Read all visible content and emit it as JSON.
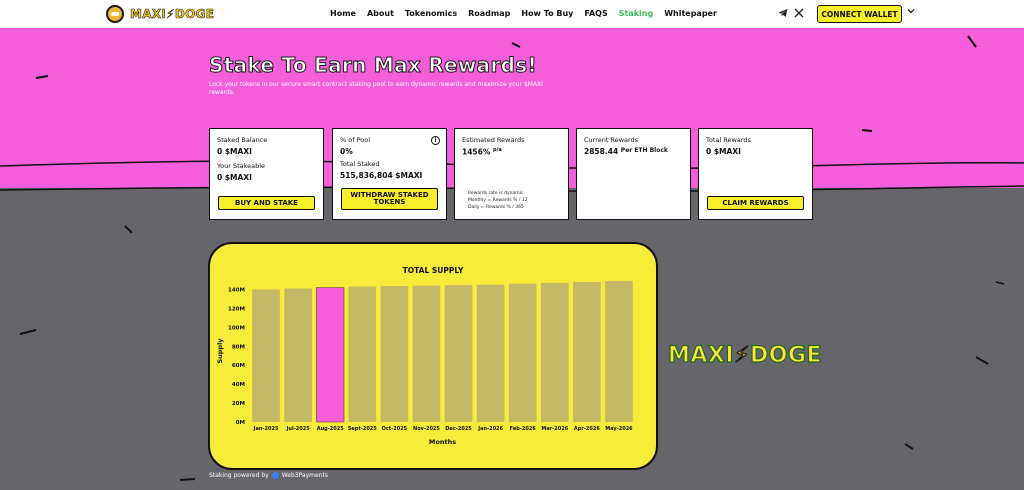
{
  "nav": {
    "links": [
      "Home",
      "About",
      "Tokenomics",
      "Roadmap",
      "How To Buy",
      "FAQS",
      "Staking",
      "Whitepaper"
    ],
    "active_index": 6,
    "logo_text": "MAXI",
    "logo_text2": "DOGE",
    "connect_label": "CONNECT WALLET",
    "telegram_icon": "telegram-icon",
    "x_icon": "x-icon"
  },
  "hero": {
    "title": "Stake To Earn Max Rewards!",
    "desc": "Lock your tokens in our secure smart contract staking pool to earn dynamic rewards and maximize your $MAXI rewards."
  },
  "cards": {
    "staked_balance_label": "Staked Balance",
    "staked_balance_value": "0 $MAXI",
    "stakeable_label": "Your Stakeable",
    "stakeable_value": "0 $MAXI",
    "buy_stake_label": "BUY AND STAKE",
    "pool_label": "% of Pool",
    "pool_value": "0%",
    "total_staked_label": "Total Staked",
    "total_staked_value": "515,836,804 $MAXI",
    "withdraw_label_1": "WITHDRAW STAKED",
    "withdraw_label_2": "TOKENS",
    "est_rewards_label": "Estimated Rewards",
    "est_rewards_value": "1456%",
    "est_rewards_unit": "p/a",
    "rewards_note_1": "Rewards rate is dynamic",
    "rewards_note_2": "Monthly = Rewards % / 12",
    "rewards_note_3": "Daily = Rewards % / 365",
    "current_rewards_label": "Current Rewards",
    "current_rewards_value": "2858.44",
    "current_rewards_unit": "Per ETH Block",
    "total_rewards_label": "Total Rewards",
    "total_rewards_value": "0 $MAXI",
    "claim_label": "CLAIM REWARDS"
  },
  "chart_data": {
    "type": "bar",
    "title": "TOTAL SUPPLY",
    "xlabel": "Months",
    "ylabel": "Supply",
    "categories": [
      "Jan-2025",
      "Jul-2025",
      "Aug-2025",
      "Sept-2025",
      "Oct-2025",
      "Nov-2025",
      "Dec-2025",
      "Jan-2026",
      "Feb-2026",
      "Mar-2026",
      "Apr-2026",
      "May-2026"
    ],
    "values": [
      140,
      141,
      142,
      143,
      143.5,
      144,
      144.5,
      145,
      146,
      147,
      148,
      149
    ],
    "unit": "M",
    "ylim": [
      0,
      150
    ],
    "yticks": [
      "0M",
      "20M",
      "40M",
      "60M",
      "80M",
      "100M",
      "120M",
      "140M"
    ],
    "ytick_values": [
      0,
      20,
      40,
      60,
      80,
      100,
      120,
      140
    ],
    "highlight_index": 2,
    "bar_color": "#c3b865",
    "highlight_color": "#f55edb"
  },
  "big_logo": {
    "text1": "MAXI",
    "text2": "DOGE"
  },
  "footer": {
    "text": "Staking powered by",
    "brand": "Web3Payments"
  },
  "colors": {
    "pink": "#f55edb",
    "yellow": "#f9ee2a",
    "gray": "#66656a",
    "active_nav": "#39c05a"
  }
}
